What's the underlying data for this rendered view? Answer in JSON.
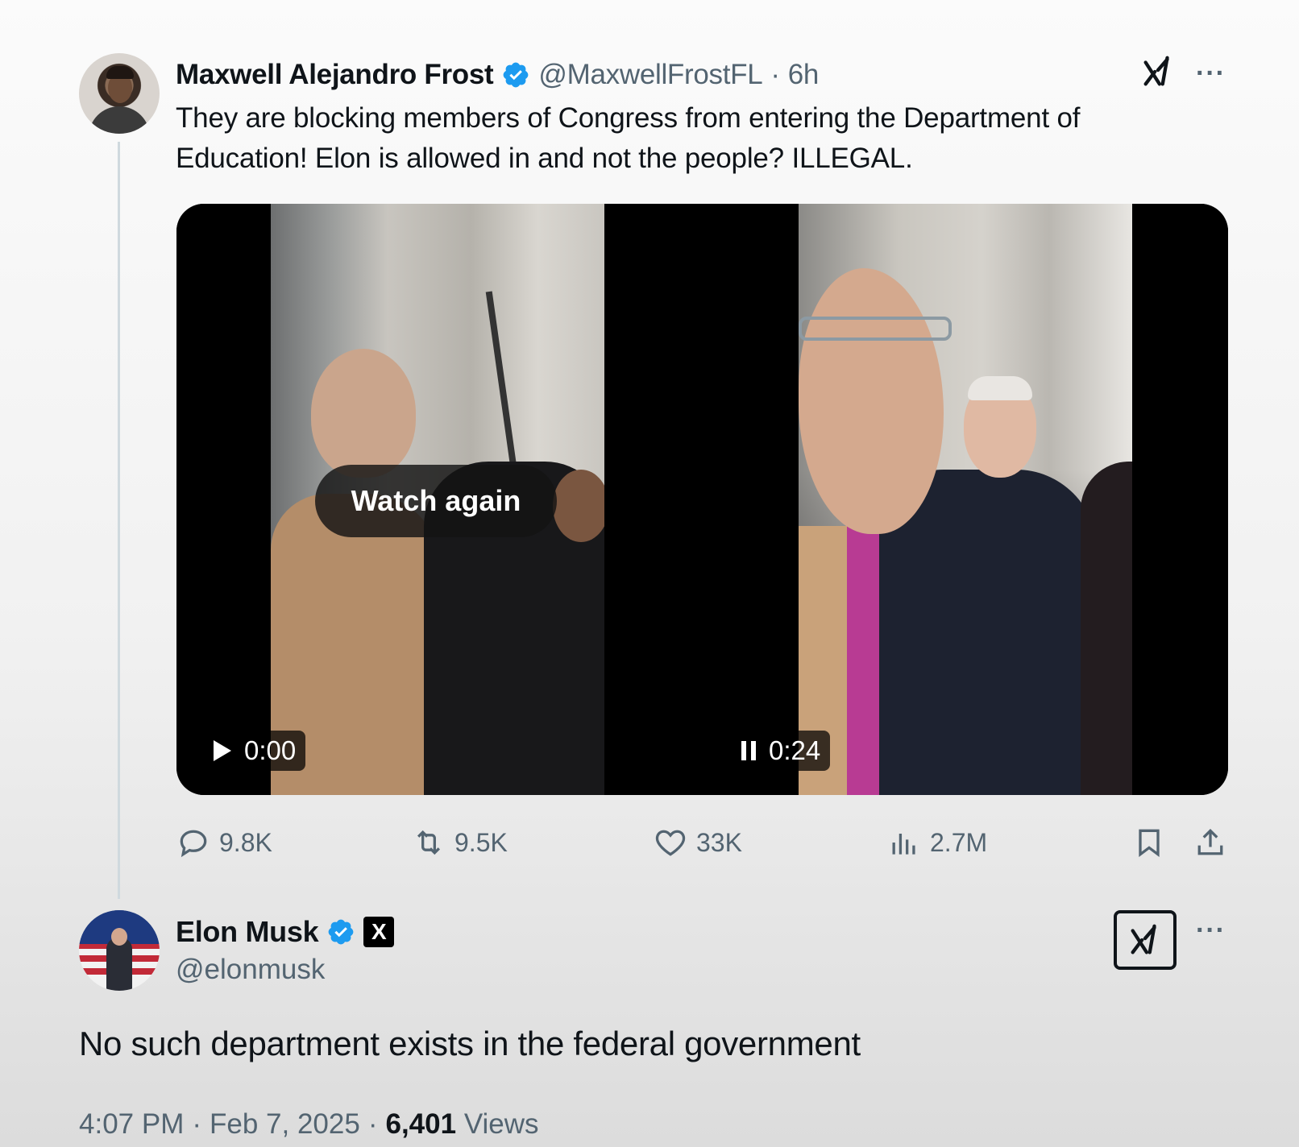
{
  "tweet": {
    "author_name": "Maxwell Alejandro Frost",
    "author_handle": "@MaxwellFrostFL",
    "separator": "·",
    "time_ago": "6h",
    "more_label": "···",
    "text": "They are blocking members of Congress from entering the Department of Education! Elon is allowed in and not the people? ILLEGAL.",
    "videos": [
      {
        "overlay": "Watch again",
        "timestamp": "0:00",
        "state_icon": "play-icon"
      },
      {
        "overlay": "",
        "timestamp": "0:24",
        "state_icon": "pause-icon"
      }
    ],
    "stats": {
      "replies": "9.8K",
      "reposts": "9.5K",
      "likes": "33K",
      "views": "2.7M"
    }
  },
  "reply": {
    "author_name": "Elon Musk",
    "author_handle": "@elonmusk",
    "affiliate_badge": "X",
    "more_label": "···",
    "text": "No such department exists in the federal government",
    "time": "4:07 PM",
    "date": "Feb 7, 2025",
    "views_count": "6,401",
    "views_label": "Views",
    "separator": "·"
  },
  "colors": {
    "verified_blue": "#1d9bf0",
    "secondary_text": "#536471",
    "primary_text": "#0f1419"
  }
}
